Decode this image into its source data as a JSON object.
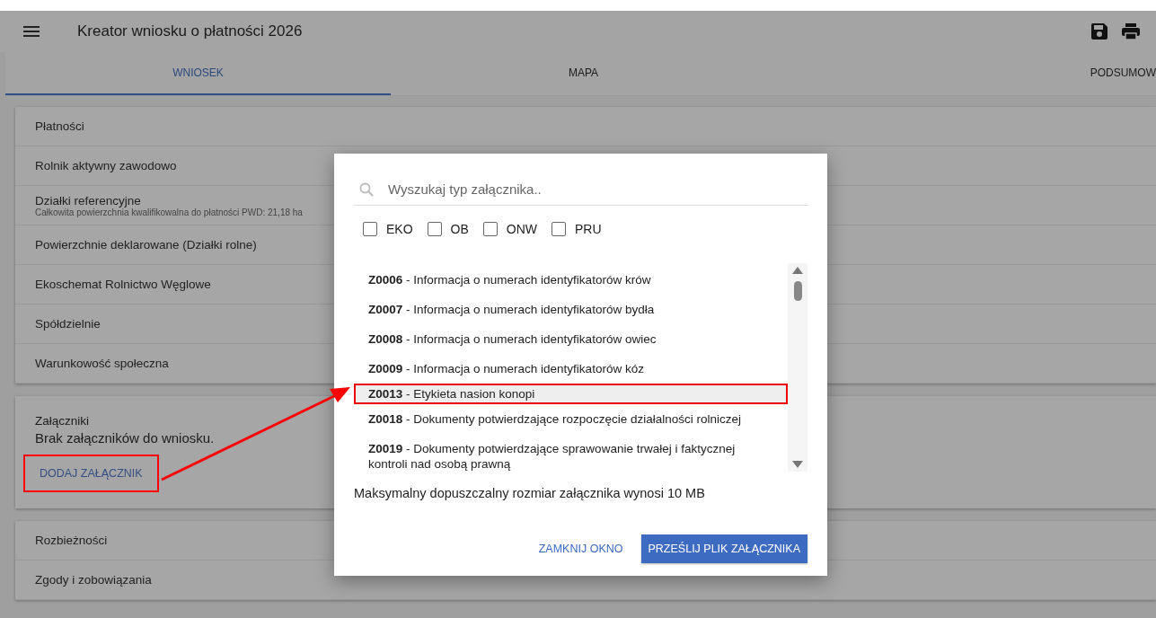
{
  "app_bar": {
    "title": "Kreator wniosku o płatności 2026"
  },
  "tabs": [
    {
      "label": "WNIOSEK",
      "selected": true
    },
    {
      "label": "MAPA",
      "selected": false
    },
    {
      "label": "PODSUMOW",
      "selected": false
    }
  ],
  "sections": [
    {
      "title": "Płatności"
    },
    {
      "title": "Rolnik aktywny zawodowo"
    },
    {
      "title": "Działki referencyjne",
      "subtitle": "Całkowita powierzchnia kwalifikowalna do płatności PWD: 21,18 ha"
    },
    {
      "title": "Powierzchnie deklarowane (Działki rolne)"
    },
    {
      "title": "Ekoschemat Rolnictwo Węglowe"
    },
    {
      "title": "Spółdzielnie"
    },
    {
      "title": "Warunkowość społeczna"
    }
  ],
  "attachments": {
    "title": "Załączniki",
    "empty_text": "Brak załączników do wniosku.",
    "add_button": {
      "label": "DODAJ ZAŁĄCZNIK",
      "highlighted": true
    }
  },
  "sections_after": [
    {
      "title": "Rozbieżności"
    },
    {
      "title": "Zgody i zobowiązania"
    }
  ],
  "dialog": {
    "search": {
      "placeholder": "Wyszukaj typ załącznika.."
    },
    "filters": [
      {
        "label": "EKO",
        "checked": false
      },
      {
        "label": "OB",
        "checked": false
      },
      {
        "label": "ONW",
        "checked": false
      },
      {
        "label": "PRU",
        "checked": false
      }
    ],
    "items": [
      {
        "label": "**Z0006** - Informacja o numerach identyfikatorów krów",
        "selected": false
      },
      {
        "label": "**Z0007** - Informacja o numerach identyfikatorów bydła",
        "selected": false
      },
      {
        "label": "**Z0008** - Informacja o numerach identyfikatorów owiec",
        "selected": false
      },
      {
        "label": "**Z0009** - Informacja o numerach identyfikatorów kóz",
        "selected": false
      },
      {
        "label": "**Z0013** - Etykieta nasion konopi",
        "selected": true
      },
      {
        "label": "**Z0018** - Dokumenty potwierdzające rozpoczęcie działalności rolniczej",
        "selected": false
      },
      {
        "label": "**Z0019** - Dokumenty potwierdzające sprawowanie trwałej i faktycznej kontroli nad osobą prawną",
        "selected": false
      }
    ],
    "note": "Maksymalny dopuszczalny rozmiar załącznika wynosi 10 MB",
    "buttons": [
      {
        "label": "ZAMKNIJ OKNO",
        "kind": "text"
      },
      {
        "label": "PRZEŚLIJ PLIK ZAŁĄCZNIKA",
        "kind": "primary"
      }
    ]
  }
}
